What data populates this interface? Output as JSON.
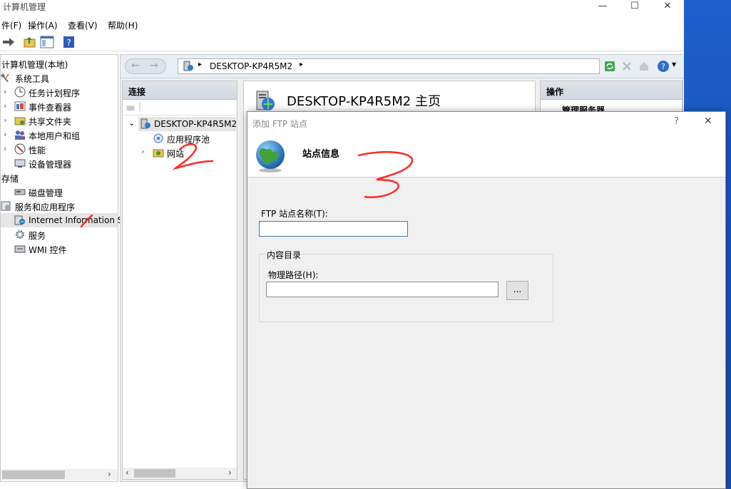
{
  "window": {
    "title": "计算机管理",
    "min_glyph": "—",
    "max_glyph": "☐",
    "close_glyph": "✕"
  },
  "menu": [
    "件(F)",
    "操作(A)",
    "查看(V)",
    "帮助(H)"
  ],
  "left_tree": {
    "items": [
      {
        "label": "计算机管理(本地)",
        "icon": "computer-management-icon"
      },
      {
        "label": "系统工具",
        "icon": "tools-icon"
      },
      {
        "label": "任务计划程序",
        "icon": "clock-icon"
      },
      {
        "label": "事件查看器",
        "icon": "event-viewer-icon"
      },
      {
        "label": "共享文件夹",
        "icon": "shared-folder-icon"
      },
      {
        "label": "本地用户和组",
        "icon": "users-icon"
      },
      {
        "label": "性能",
        "icon": "performance-icon"
      },
      {
        "label": "设备管理器",
        "icon": "device-manager-icon"
      },
      {
        "label": "存储",
        "icon": "storage-icon"
      },
      {
        "label": "磁盘管理",
        "icon": "disk-icon"
      },
      {
        "label": "服务和应用程序",
        "icon": "services-apps-icon"
      },
      {
        "label": "Internet Information S",
        "icon": "iis-icon"
      },
      {
        "label": "服务",
        "icon": "services-gear-icon"
      },
      {
        "label": "WMI 控件",
        "icon": "wmi-icon"
      }
    ]
  },
  "iis": {
    "address": "DESKTOP-KP4R5M2",
    "connections_header": "连接",
    "tree": [
      {
        "label": "DESKTOP-KP4R5M2"
      },
      {
        "label": "应用程序池"
      },
      {
        "label": "网站"
      }
    ],
    "content_title": "DESKTOP-KP4R5M2 主页",
    "actions_header": "操作",
    "actions_item": "管理服务器"
  },
  "dialog": {
    "title": "添加 FTP 站点",
    "help_glyph": "?",
    "close_glyph": "✕",
    "section_title": "站点信息",
    "site_name_label": "FTP 站点名称(T):",
    "site_name_value": "",
    "content_dir_group": "内容目录",
    "physical_path_label": "物理路径(H):",
    "physical_path_value": "",
    "browse_label": "..."
  },
  "annotations": {
    "mark1": "1",
    "mark2": "2",
    "mark3": "3",
    "color": "#ff2a1f"
  }
}
